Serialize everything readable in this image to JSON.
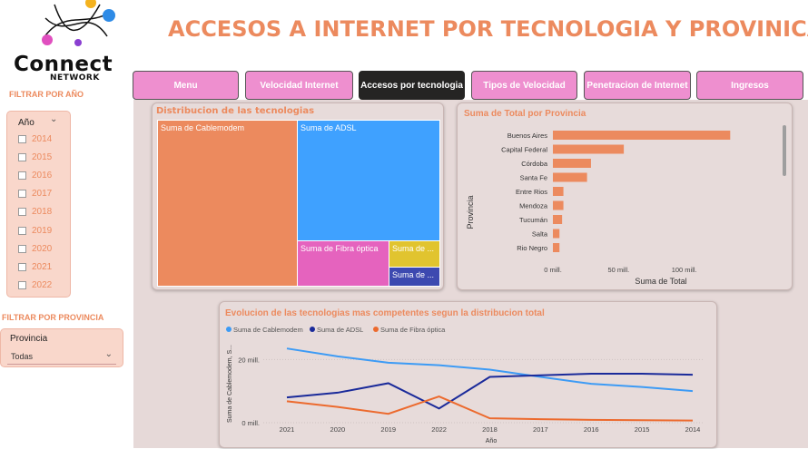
{
  "header": {
    "logo_text": "Connect",
    "logo_sub": "NETWORK",
    "title": "ACCESOS A INTERNET POR TECNOLOGIA Y PROVINICA"
  },
  "nav": [
    {
      "label": "Menu",
      "active": false
    },
    {
      "label": "Velocidad Internet",
      "active": false
    },
    {
      "label": "Accesos por tecnologia",
      "active": true
    },
    {
      "label": "Tipos de Velocidad",
      "active": false
    },
    {
      "label": "Penetracion de Internet",
      "active": false
    },
    {
      "label": "Ingresos",
      "active": false
    }
  ],
  "filters": {
    "year_label": "FILTRAR POR AÑO",
    "year_header": "Año",
    "years": [
      "2014",
      "2015",
      "2016",
      "2017",
      "2018",
      "2019",
      "2020",
      "2021",
      "2022"
    ],
    "province_label": "FILTRAR POR PROVINCIA",
    "province_header": "Provincia",
    "province_value": "Todas"
  },
  "treemap": {
    "title": "Distribucion de las tecnologias",
    "tiles": [
      {
        "label": "Suma de Cablemodem",
        "color": "#ec8a5e"
      },
      {
        "label": "Suma de ADSL",
        "color": "#3fa1ff"
      },
      {
        "label": "Suma de Fibra óptica",
        "color": "#e563be"
      },
      {
        "label": "Suma de ...",
        "color": "#e1c42f"
      },
      {
        "label": "Suma de ...",
        "color": "#3d49b0"
      }
    ]
  },
  "colors": {
    "accent": "#ec8a5e",
    "nav_bg": "#ee8fcf",
    "nav_active": "#252423",
    "canvas": "#e6d9d8"
  },
  "chart_data": [
    {
      "type": "bar",
      "orientation": "horizontal",
      "title": "Suma de Total por Provincia",
      "xlabel": "Suma de Total",
      "ylabel": "Provincia",
      "categories": [
        "Buenos Aires",
        "Capital Federal",
        "Córdoba",
        "Santa Fe",
        "Entre Rios",
        "Mendoza",
        "Tucumán",
        "Salta",
        "Rio Negro"
      ],
      "values": [
        135,
        54,
        29,
        26,
        8,
        8,
        7,
        5,
        5
      ],
      "xticks": [
        "0 mill.",
        "50 mill.",
        "100 mill."
      ],
      "xlim": [
        0,
        150
      ],
      "color": "#ec8a5e"
    },
    {
      "type": "line",
      "title": "Evolucion de las tecnologias mas competentes segun la distribucion total",
      "xlabel": "Año",
      "ylabel": "Suma de Cablemodem, S...",
      "categories": [
        "2021",
        "2020",
        "2019",
        "2022",
        "2018",
        "2017",
        "2016",
        "2015",
        "2014"
      ],
      "yticks": [
        "0 mill.",
        "20 mill."
      ],
      "ylim": [
        0,
        27
      ],
      "series": [
        {
          "name": "Suma de Cablemodem",
          "color": "#3d9bf5",
          "values": [
            23.5,
            21,
            19,
            18.2,
            16.8,
            14.5,
            12.3,
            11.3,
            10
          ]
        },
        {
          "name": "Suma de ADSL",
          "color": "#1a2a9a",
          "values": [
            8,
            9.5,
            12.5,
            4.5,
            14.5,
            15,
            15.5,
            15.5,
            15.2
          ]
        },
        {
          "name": "Suma de Fibra óptica",
          "color": "#ec6a2e",
          "values": [
            6.8,
            5,
            2.8,
            8.3,
            1.4,
            1.1,
            0.9,
            0.8,
            0.7
          ]
        }
      ]
    }
  ]
}
